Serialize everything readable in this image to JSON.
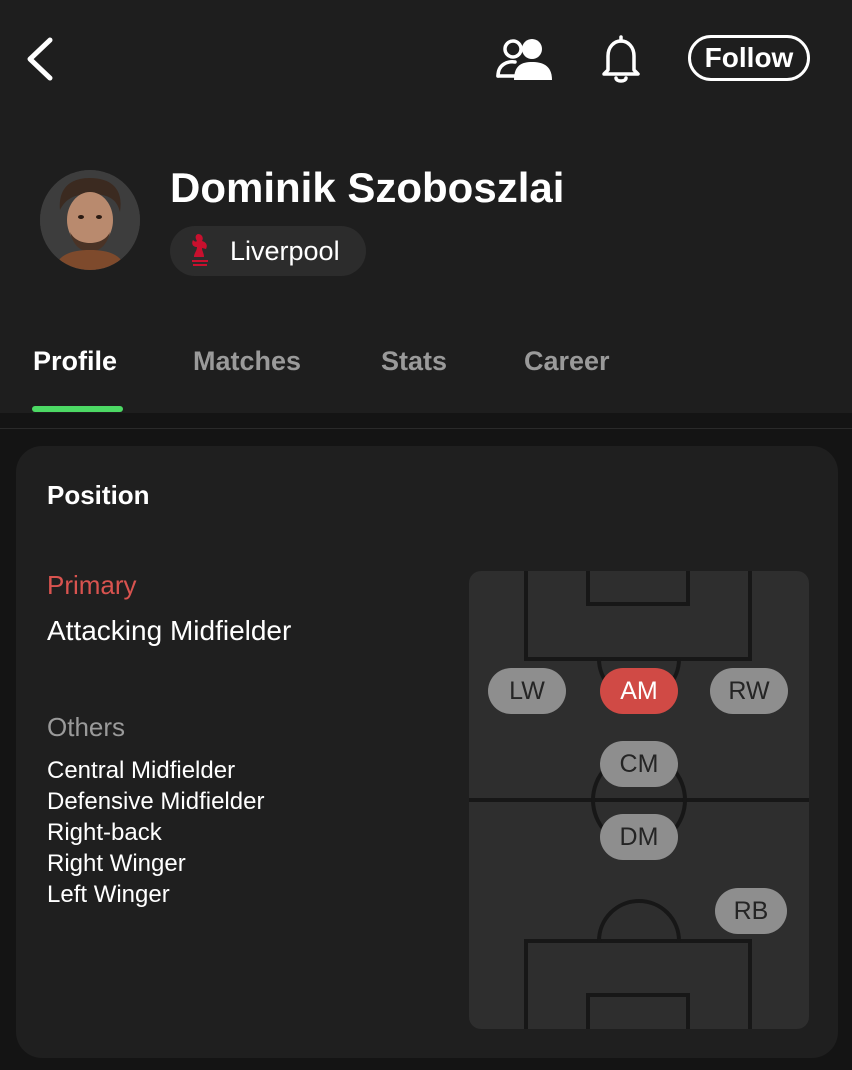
{
  "header": {
    "follow_label": "Follow",
    "icons": [
      "back-icon",
      "friends-icon",
      "bell-icon"
    ]
  },
  "player": {
    "name": "Dominik Szoboszlai",
    "team": "Liverpool"
  },
  "tabs": [
    {
      "label": "Profile",
      "active": true
    },
    {
      "label": "Matches",
      "active": false
    },
    {
      "label": "Stats",
      "active": false
    },
    {
      "label": "Career",
      "active": false
    }
  ],
  "position_card": {
    "title": "Position",
    "primary_label": "Primary",
    "primary_value": "Attacking Midfielder",
    "others_label": "Others",
    "others": [
      "Central Midfielder",
      "Defensive Midfielder",
      "Right-back",
      "Right Winger",
      "Left Winger"
    ],
    "pitch_positions": [
      {
        "code": "LW",
        "primary": false
      },
      {
        "code": "AM",
        "primary": true
      },
      {
        "code": "RW",
        "primary": false
      },
      {
        "code": "CM",
        "primary": false
      },
      {
        "code": "DM",
        "primary": false
      },
      {
        "code": "RB",
        "primary": false
      }
    ]
  },
  "colors": {
    "accent": "#4cd964",
    "primary_position": "#d04a45",
    "secondary_position": "#8e8e8e",
    "background": "#141414",
    "header_background": "#1e1e1e",
    "card_background": "#1f1f1f"
  }
}
